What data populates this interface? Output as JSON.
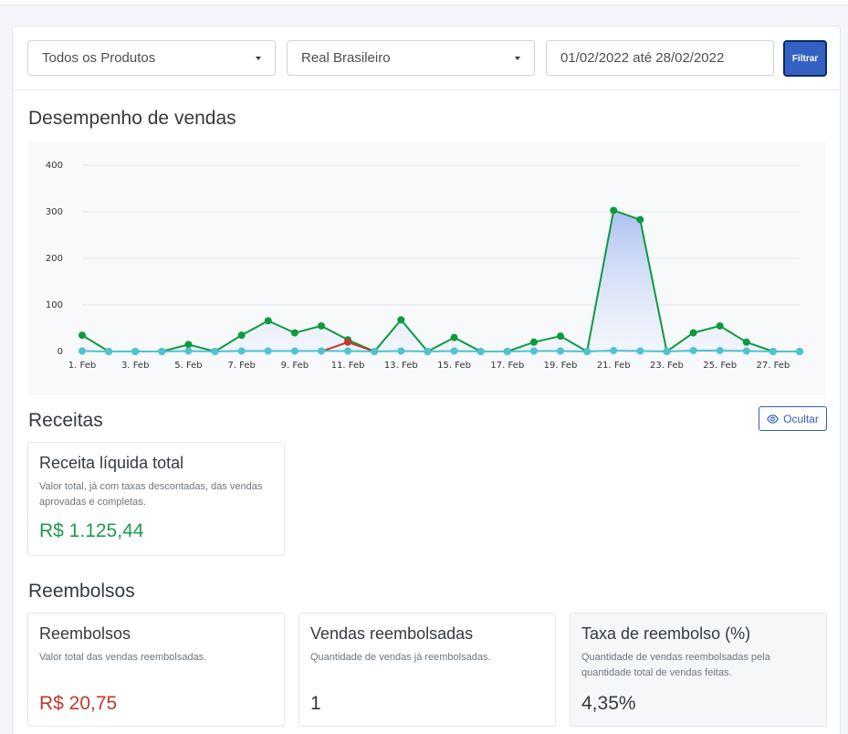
{
  "filters": {
    "product": "Todos os Produtos",
    "currency": "Real Brasileiro",
    "date_range": "01/02/2022 até 28/02/2022",
    "filter_label": "Filtrar"
  },
  "sales": {
    "title": "Desempenho de vendas"
  },
  "chart_data": {
    "type": "line",
    "x": [
      "1. Feb",
      "2. Feb",
      "3. Feb",
      "4. Feb",
      "5. Feb",
      "6. Feb",
      "7. Feb",
      "8. Feb",
      "9. Feb",
      "10. Feb",
      "11. Feb",
      "12. Feb",
      "13. Feb",
      "14. Feb",
      "15. Feb",
      "16. Feb",
      "17. Feb",
      "18. Feb",
      "19. Feb",
      "20. Feb",
      "21. Feb",
      "22. Feb",
      "23. Feb",
      "24. Feb",
      "25. Feb",
      "26. Feb",
      "27. Feb",
      "28. Feb"
    ],
    "x_tick_labels": [
      "1. Feb",
      "3. Feb",
      "5. Feb",
      "7. Feb",
      "9. Feb",
      "11. Feb",
      "13. Feb",
      "15. Feb",
      "17. Feb",
      "19. Feb",
      "21. Feb",
      "23. Feb",
      "25. Feb",
      "27. Feb"
    ],
    "y_ticks": [
      0,
      100,
      200,
      300,
      400
    ],
    "ylim": [
      0,
      400
    ],
    "grid": true,
    "series": [
      {
        "color": "#0c9a3c",
        "fill": true,
        "values": [
          35,
          0,
          0,
          0,
          15,
          0,
          35,
          66,
          40,
          55,
          25,
          0,
          68,
          0,
          30,
          0,
          0,
          20,
          33,
          0,
          303,
          283,
          0,
          40,
          55,
          20,
          0,
          0
        ]
      },
      {
        "color": "#c0392b",
        "fill": false,
        "values": [
          0,
          0,
          0,
          0,
          0,
          0,
          0,
          0,
          0,
          0,
          20,
          0,
          0,
          0,
          0,
          0,
          0,
          0,
          0,
          0,
          0,
          0,
          0,
          0,
          0,
          0,
          0,
          0
        ]
      },
      {
        "color": "#4fc3d0",
        "fill": false,
        "values": [
          1,
          0,
          0,
          0,
          1,
          0,
          1,
          1,
          1,
          1,
          1,
          0,
          1,
          0,
          1,
          0,
          0,
          1,
          1,
          0,
          2,
          1,
          0,
          2,
          2,
          1,
          0,
          0
        ]
      }
    ]
  },
  "revenue": {
    "title": "Receitas",
    "hide_label": "Ocultar",
    "net": {
      "title": "Receita líquida total",
      "desc": "Valor total, já com taxas descontadas, das vendas aprovadas e completas.",
      "value": "R$ 1.125,44",
      "color": "#1e9b4f"
    }
  },
  "refunds": {
    "title": "Reembolsos",
    "cards": [
      {
        "title": "Reembolsos",
        "desc": "Valor total das vendas reembolsadas.",
        "value": "R$ 20,75",
        "color": "#c0392b"
      },
      {
        "title": "Vendas reembolsadas",
        "desc": "Quantidade de vendas já reembolsadas.",
        "value": "1",
        "color": "#343a40"
      },
      {
        "title": "Taxa de reembolso (%)",
        "desc": "Quantidade de vendas reembolsadas pela quantidade total de vendas feitas.",
        "value": "4,35%",
        "color": "#343a40"
      }
    ]
  },
  "icons": {
    "hide": "eye-icon",
    "dropdown": "chevron-down-icon"
  }
}
